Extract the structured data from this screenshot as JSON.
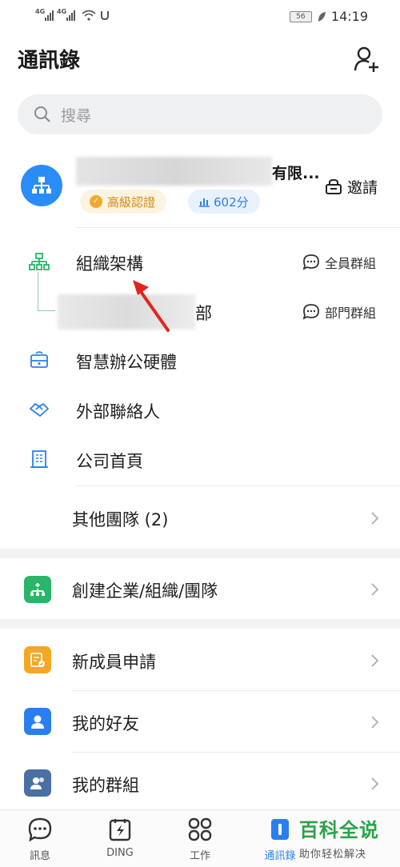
{
  "status": {
    "net1": "4G",
    "net2": "4G",
    "battery": "56",
    "time": "14:19"
  },
  "header": {
    "title": "通訊錄"
  },
  "search": {
    "placeholder": "搜尋"
  },
  "org": {
    "name": "有限...",
    "cert_label": "高級認證",
    "score_label": "602分",
    "invite_label": "邀請"
  },
  "tree": {
    "root_label": "組織架構",
    "root_group": "全員群組",
    "dept_label": "部",
    "dept_group": "部門群組"
  },
  "menu": {
    "smart_office": "智慧辦公硬體",
    "external": "外部聯絡人",
    "homepage": "公司首頁",
    "other_teams": "其他團隊 (2)"
  },
  "create_org": "創建企業/組織/團隊",
  "lists": {
    "new_member": "新成員申請",
    "friends": "我的好友",
    "groups": "我的群組"
  },
  "nav": {
    "messages": "訊息",
    "ding": "DING",
    "work": "工作",
    "contacts": "通訊錄"
  },
  "watermark": {
    "title": "百科全说",
    "subtitle": "助你轻松解决"
  },
  "colors": {
    "accent": "#2a7ff0",
    "green": "#2ab56a",
    "cert": "#f0a92c"
  }
}
